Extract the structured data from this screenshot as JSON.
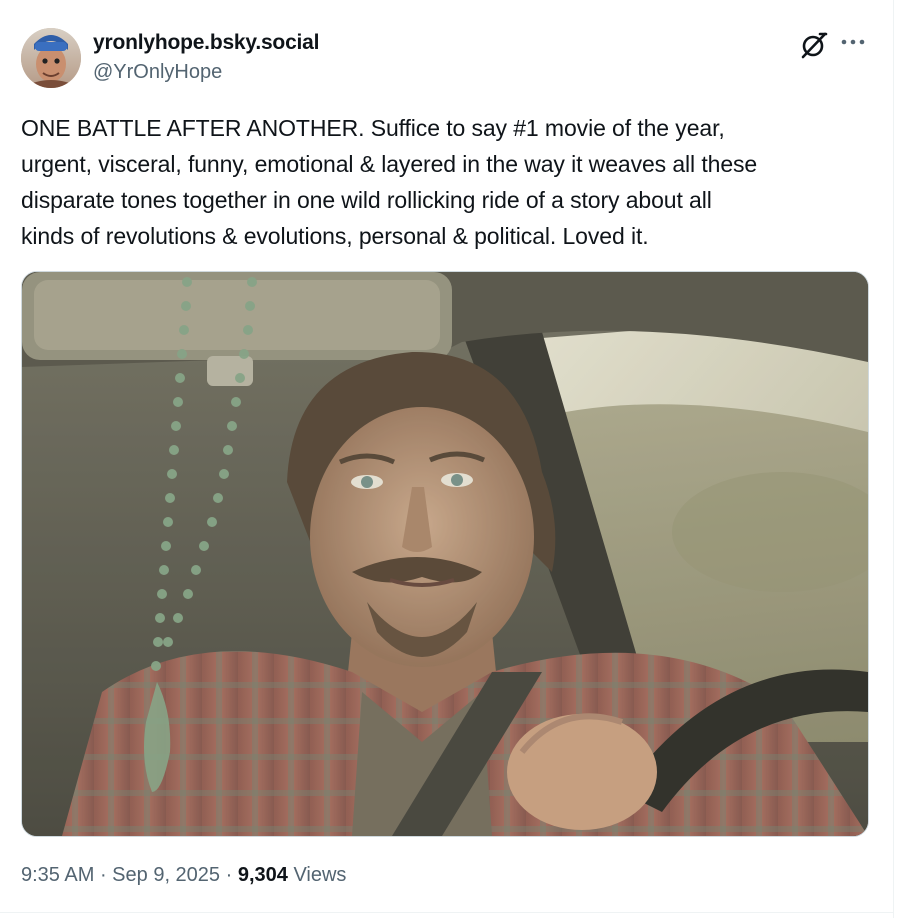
{
  "author": {
    "display_name": "yronlyhope.bsky.social",
    "handle": "@YrOnlyHope",
    "avatar_icon": "profile-photo"
  },
  "actions": {
    "grok_icon": "grok-icon",
    "more_icon": "more-dots-icon"
  },
  "post": {
    "text": "ONE BATTLE AFTER ANOTHER. Suffice to say #1 movie of the year,\nurgent, visceral, funny, emotional & layered in the way it weaves all these\ndisparate tones together in one wild rollicking ride of a story about all\nkinds of revolutions & evolutions, personal & political. Loved it."
  },
  "media": {
    "type": "photo"
  },
  "meta": {
    "time": "9:35 AM",
    "separator": " · ",
    "date": "Sep 9, 2025",
    "views_count": "9,304",
    "views_label": " Views"
  },
  "colors": {
    "text_primary": "#0f1419",
    "text_secondary": "#536471",
    "border": "#cfd9de"
  }
}
